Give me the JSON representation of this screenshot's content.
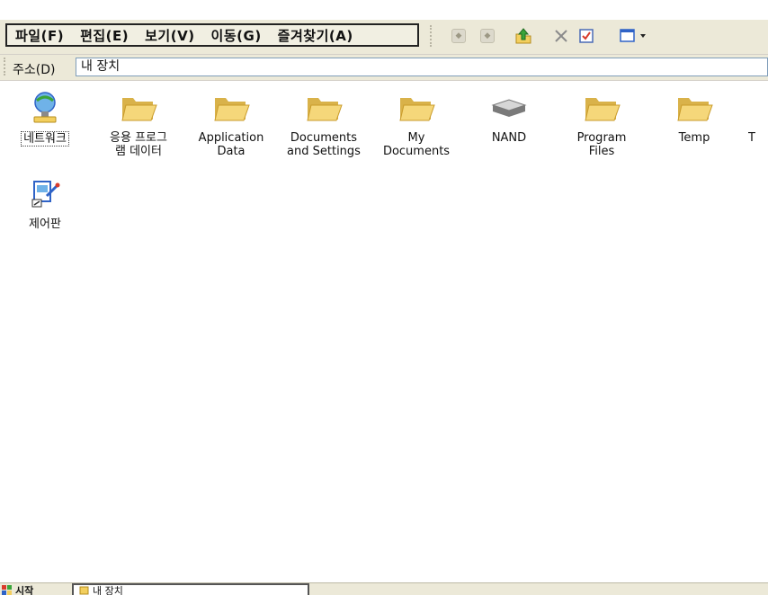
{
  "menu": {
    "items": [
      {
        "label": "파일(F)"
      },
      {
        "label": "편집(E)"
      },
      {
        "label": "보기(V)"
      },
      {
        "label": "이동(G)"
      },
      {
        "label": "즐겨찾기(A)"
      }
    ]
  },
  "address": {
    "label": "주소(D)",
    "value": "내 장치"
  },
  "files": [
    {
      "label": "네트워크",
      "icon": "network-icon",
      "selected": true
    },
    {
      "label": "응용 프로그\n램 데이터",
      "icon": "folder-icon"
    },
    {
      "label": "Application\nData",
      "icon": "folder-icon"
    },
    {
      "label": "Documents\nand Settings",
      "icon": "folder-icon"
    },
    {
      "label": "My\nDocuments",
      "icon": "folder-icon"
    },
    {
      "label": "NAND",
      "icon": "drive-icon"
    },
    {
      "label": "Program\nFiles",
      "icon": "folder-icon"
    },
    {
      "label": "Temp",
      "icon": "folder-icon"
    },
    {
      "label": "T",
      "icon": "folder-icon"
    },
    {
      "label": "제어판",
      "icon": "control-panel-icon"
    }
  ],
  "taskbar": {
    "start_label": "시작",
    "task_label": "내 장치"
  },
  "colors": {
    "chrome": "#ece9d8",
    "folder": "#f5d77a",
    "folder_dark": "#d9b24a",
    "accent_blue": "#2f63c7"
  }
}
